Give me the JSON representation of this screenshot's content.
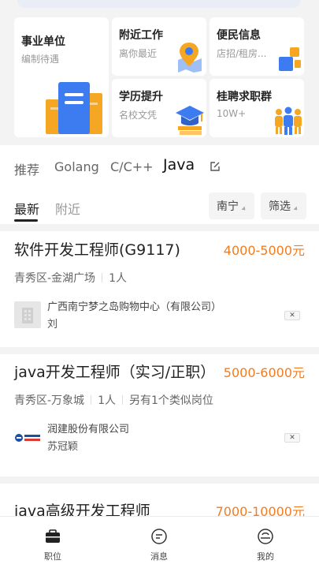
{
  "categories": {
    "big": {
      "title": "事业单位",
      "subtitle": "编制待遇"
    },
    "near": {
      "title": "附近工作",
      "subtitle": "离你最近"
    },
    "info": {
      "title": "便民信息",
      "subtitle": "店招/租房..."
    },
    "edu": {
      "title": "学历提升",
      "subtitle": "名校文凭"
    },
    "group": {
      "title": "桂聘求职群",
      "subtitle": "10W+"
    }
  },
  "tabs": {
    "primary": [
      "推荐",
      "Golang",
      "C/C++",
      "Java"
    ],
    "active_primary": "Java",
    "secondary": [
      "最新",
      "附近"
    ],
    "filter_city": "南宁",
    "filter_label": "筛选"
  },
  "jobs": [
    {
      "title": "软件开发工程师(G9117)",
      "salary": "4000-5000元",
      "location": "青秀区-金湖广场",
      "headcount": "1人",
      "extra": "",
      "company": "广西南宁梦之岛购物中心（有限公司）",
      "contact": "刘"
    },
    {
      "title": "java开发工程师（实习/正职）",
      "salary": "5000-6000元",
      "location": "青秀区-万象城",
      "headcount": "1人",
      "extra": "另有1个类似岗位",
      "company": "润建股份有限公司",
      "contact": "苏冠颖"
    },
    {
      "title": "java高级开发工程师",
      "salary": "7000-10000元"
    }
  ],
  "close_glyph": "✕",
  "bottom_nav": [
    {
      "label": "职位",
      "icon": "briefcase-icon"
    },
    {
      "label": "消息",
      "icon": "message-icon"
    },
    {
      "label": "我的",
      "icon": "profile-icon"
    }
  ],
  "colors": {
    "accent": "#f27c20",
    "blue": "#3d7bf0",
    "orange": "#f5a623"
  }
}
